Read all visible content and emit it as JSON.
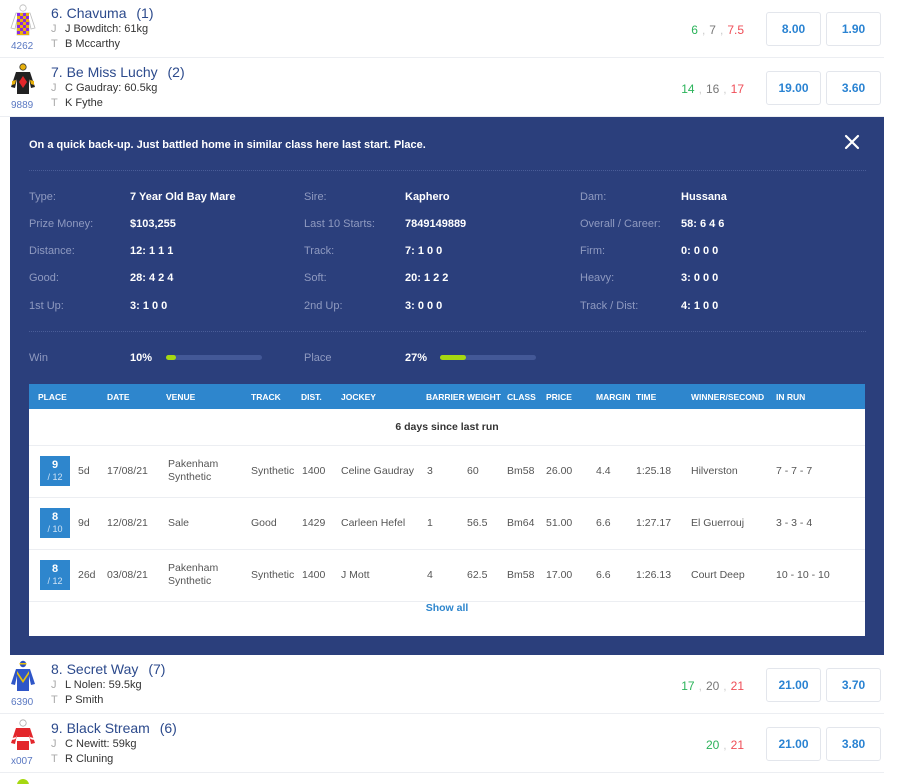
{
  "runners_top": [
    {
      "number": "6.",
      "name": "Chavuma",
      "barrier": "(1)",
      "code": "4262",
      "jockey_prefix": "J",
      "jockey": "J Bowditch: 61kg",
      "trainer_prefix": "T",
      "trainer": "B Mccarthy",
      "flucs": [
        "6",
        "7",
        "7.5"
      ],
      "win_odds": "8.00",
      "place_odds": "1.90",
      "silk": "purple-yellow-diamonds-silk-icon"
    },
    {
      "number": "7.",
      "name": "Be Miss Luchy",
      "barrier": "(2)",
      "code": "9889",
      "jockey_prefix": "J",
      "jockey": "C Gaudray: 60.5kg",
      "trainer_prefix": "T",
      "trainer": "K Fythe",
      "flucs": [
        "14",
        "16",
        "17"
      ],
      "win_odds": "19.00",
      "place_odds": "3.60",
      "silk": "black-red-diamond-silk-icon"
    }
  ],
  "detail": {
    "comment": "On a quick back-up. Just battled home in similar class here last start. Place.",
    "close_icon": "close-icon",
    "stats": [
      {
        "label": "Type:",
        "value": "7 Year Old Bay Mare"
      },
      {
        "label": "Sire:",
        "value": "Kaphero"
      },
      {
        "label": "Dam:",
        "value": "Hussana"
      },
      {
        "label": "Prize Money:",
        "value": "$103,255"
      },
      {
        "label": "Last 10 Starts:",
        "value": "7849149889"
      },
      {
        "label": "Overall / Career:",
        "value": "58: 6 4 6"
      },
      {
        "label": "Distance:",
        "value": "12: 1 1 1"
      },
      {
        "label": "Track:",
        "value": "7: 1 0 0"
      },
      {
        "label": "Firm:",
        "value": "0: 0 0 0"
      },
      {
        "label": "Good:",
        "value": "28: 4 2 4"
      },
      {
        "label": "Soft:",
        "value": "20: 1 2 2"
      },
      {
        "label": "Heavy:",
        "value": "3: 0 0 0"
      },
      {
        "label": "1st Up:",
        "value": "3: 1 0 0"
      },
      {
        "label": "2nd Up:",
        "value": "3: 0 0 0"
      },
      {
        "label": "Track / Dist:",
        "value": "4: 1 0 0"
      }
    ],
    "win": {
      "label": "Win",
      "value": "10%",
      "fraction": 0.1
    },
    "place": {
      "label": "Place",
      "value": "27%",
      "fraction": 0.27
    },
    "form_table": {
      "headers": [
        "PLACE",
        "DATE",
        "VENUE",
        "TRACK",
        "DIST.",
        "JOCKEY",
        "BARRIER",
        "WEIGHT",
        "CLASS",
        "PRICE",
        "MARGIN",
        "TIME",
        "WINNER/SECOND",
        "IN RUN"
      ],
      "since_last_run": "6 days since last run",
      "rows": [
        {
          "place": "9",
          "field": "/ 12",
          "days": "5d",
          "date": "17/08/21",
          "venue": [
            "Pakenham",
            "Synthetic"
          ],
          "track": "Synthetic",
          "dist": "1400",
          "jockey": "Celine Gaudray",
          "barrier": "3",
          "weight": "60",
          "class": "Bm58",
          "price": "26.00",
          "margin": "4.4",
          "time": "1:25.18",
          "winner": "Hilverston",
          "in_run": "7 - 7 - 7"
        },
        {
          "place": "8",
          "field": "/ 10",
          "days": "9d",
          "date": "12/08/21",
          "venue": [
            "Sale",
            ""
          ],
          "track": "Good",
          "dist": "1429",
          "jockey": "Carleen Hefel",
          "barrier": "1",
          "weight": "56.5",
          "class": "Bm64",
          "price": "51.00",
          "margin": "6.6",
          "time": "1:27.17",
          "winner": "El Guerrouj",
          "in_run": "3 - 3 - 4"
        },
        {
          "place": "8",
          "field": "/ 12",
          "days": "26d",
          "date": "03/08/21",
          "venue": [
            "Pakenham",
            "Synthetic"
          ],
          "track": "Synthetic",
          "dist": "1400",
          "jockey": "J Mott",
          "barrier": "4",
          "weight": "62.5",
          "class": "Bm58",
          "price": "17.00",
          "margin": "6.6",
          "time": "1:26.13",
          "winner": "Court Deep",
          "in_run": "10 - 10 - 10"
        }
      ],
      "show_all": "Show all"
    }
  },
  "runners_bottom": [
    {
      "number": "8.",
      "name": "Secret Way",
      "barrier": "(7)",
      "code": "6390",
      "jockey_prefix": "J",
      "jockey": "L Nolen: 59.5kg",
      "trainer_prefix": "T",
      "trainer": "P Smith",
      "flucs": [
        "17",
        "20",
        "21"
      ],
      "win_odds": "21.00",
      "place_odds": "3.70",
      "silk": "blue-yellow-chevron-silk-icon"
    },
    {
      "number": "9.",
      "name": "Black Stream",
      "barrier": "(6)",
      "code": "x007",
      "jockey_prefix": "J",
      "jockey": "C Newitt: 59kg",
      "trainer_prefix": "T",
      "trainer": "R Cluning",
      "flucs": [
        "20",
        "21"
      ],
      "win_odds": "21.00",
      "place_odds": "3.80",
      "silk": "red-white-hoops-silk-icon"
    }
  ],
  "colors": {
    "panel_bg": "#2b3f7c",
    "accent_blue": "#2e86cd",
    "bar_fill": "#a6d811",
    "fluc_open": "#2bb35a",
    "fluc_current": "#ef4d57",
    "runner_name": "#2c4a8c"
  }
}
